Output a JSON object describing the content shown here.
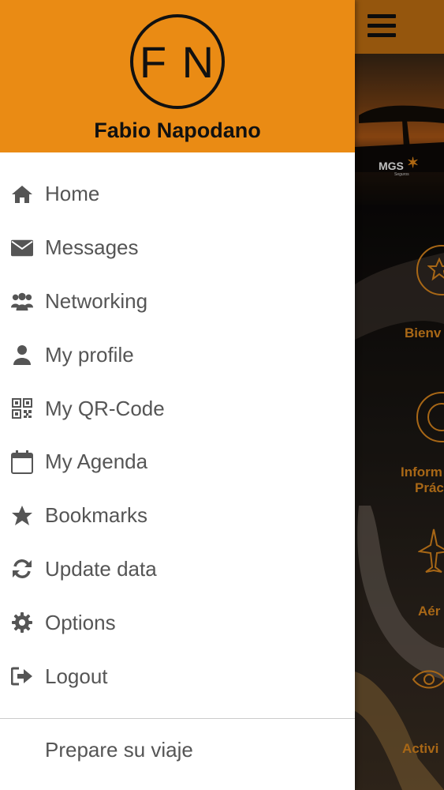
{
  "drawer": {
    "avatar_initials": "F N",
    "user_name": "Fabio Napodano",
    "menu_items": [
      {
        "label": "Home",
        "icon": "home-icon"
      },
      {
        "label": "Messages",
        "icon": "envelope-icon"
      },
      {
        "label": "Networking",
        "icon": "users-icon"
      },
      {
        "label": "My profile",
        "icon": "user-icon"
      },
      {
        "label": "My QR-Code",
        "icon": "qrcode-icon"
      },
      {
        "label": "My Agenda",
        "icon": "calendar-icon"
      },
      {
        "label": "Bookmarks",
        "icon": "star-icon"
      },
      {
        "label": "Update data",
        "icon": "refresh-icon"
      },
      {
        "label": "Options",
        "icon": "gear-icon"
      },
      {
        "label": "Logout",
        "icon": "logout-icon"
      }
    ],
    "footer_label": "Prepare su viaje"
  },
  "background_app": {
    "logo": "MGS",
    "logo_sub": "Seguros",
    "tiles": [
      {
        "label": "Bienv",
        "icon": "star-circle-icon"
      },
      {
        "label": "Inform",
        "label2": "Prác",
        "icon": "target-icon"
      },
      {
        "label": "Aér",
        "icon": "plane-icon"
      },
      {
        "label": "Activi",
        "icon": "eye-icon"
      }
    ]
  },
  "colors": {
    "accent": "#ea8b14",
    "tile_accent": "#e08a1e",
    "text_gray": "#555555"
  }
}
